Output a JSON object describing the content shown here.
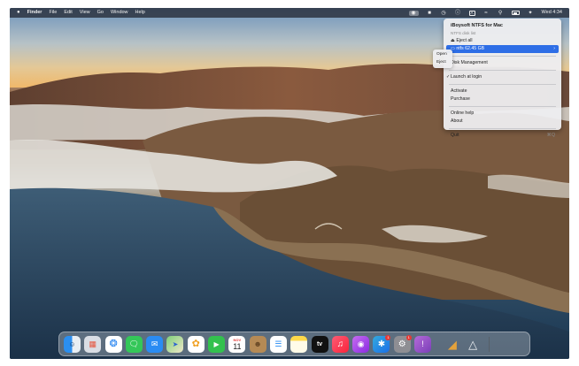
{
  "menubar": {
    "apple": "",
    "app_name": "Finder",
    "menus": [
      "File",
      "Edit",
      "View",
      "Go",
      "Window",
      "Help"
    ],
    "clock": "Wed 4:34"
  },
  "ntfs_menu": {
    "title": "iBoysoft NTFS for Mac",
    "subtitle": "NTFS disk list",
    "eject_all": "Eject all",
    "disk_item": "ntfs  62.45 GB",
    "disk_management": "Disk Management",
    "launch_at_login": "Launch at login",
    "activate": "Activate",
    "purchase": "Purchase",
    "online_help": "Online help",
    "about": "About",
    "quit": "Quit",
    "quit_shortcut": "⌘Q"
  },
  "disk_submenu": {
    "open": "Open",
    "eject": "Eject"
  },
  "dock": {
    "calendar_month": "NOV",
    "calendar_day": "11",
    "appletv_label": "tv",
    "badges": {
      "appstore": "1",
      "settings": "1"
    }
  }
}
